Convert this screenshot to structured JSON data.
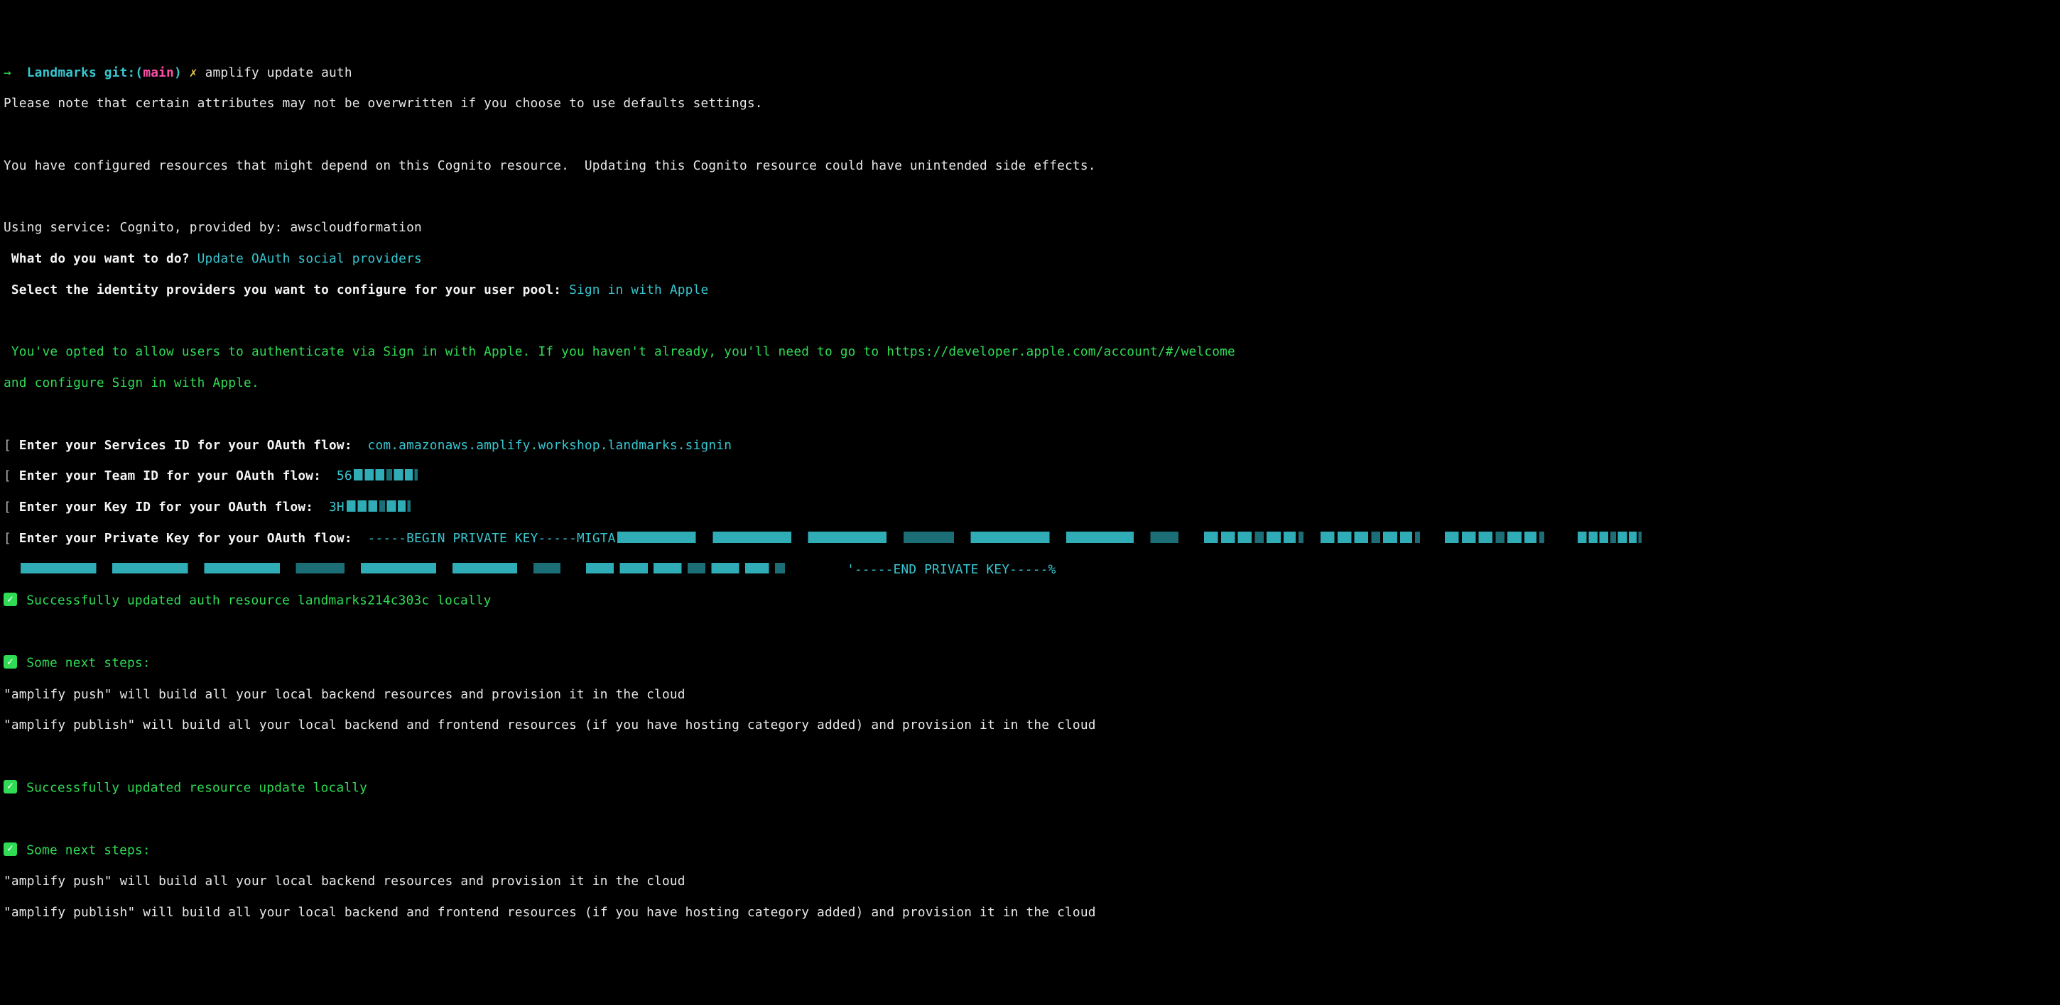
{
  "prompt": {
    "arrow": "→",
    "cwd": "Landmarks",
    "git_prefix": "git:(",
    "git_branch": "main",
    "git_suffix": ")",
    "symbol": "✗",
    "command": "amplify update auth"
  },
  "lines": {
    "note": "Please note that certain attributes may not be overwritten if you choose to use defaults settings.",
    "configured": "You have configured resources that might depend on this Cognito resource.  Updating this Cognito resource could have unintended side effects.",
    "using": "Using service: Cognito, provided by: awscloudformation",
    "q1_label": " What do you want to do?",
    "q1_answer": " Update OAuth social providers",
    "q2_label": " Select the identity providers you want to configure for your user pool:",
    "q2_answer": " Sign in with Apple",
    "opted_1": " You've opted to allow users to authenticate via Sign in with Apple. If you haven't already, you'll need to go to https://developer.apple.com/account/#/welcome",
    "opted_2": "and configure Sign in with Apple.",
    "services_label": " Enter your Services ID for your OAuth flow: ",
    "services_val": " com.amazonaws.amplify.workshop.landmarks.signin",
    "team_label": " Enter your Team ID for your OAuth flow: ",
    "team_val": " 56",
    "key_label": " Enter your Key ID for your OAuth flow: ",
    "key_val": " 3H",
    "priv_label": " Enter your Private Key for your OAuth flow: ",
    "priv_begin": " -----BEGIN PRIVATE KEY-----MIGTA",
    "priv_end": "'-----END PRIVATE KEY-----%",
    "success1": " Successfully updated auth resource landmarks214c303c locally",
    "nextsteps": " Some next steps:",
    "push": "\"amplify push\" will build all your local backend resources and provision it in the cloud",
    "publish": "\"amplify publish\" will build all your local backend and frontend resources (if you have hosting category added) and provision it in the cloud",
    "success2": " Successfully updated resource update locally"
  }
}
